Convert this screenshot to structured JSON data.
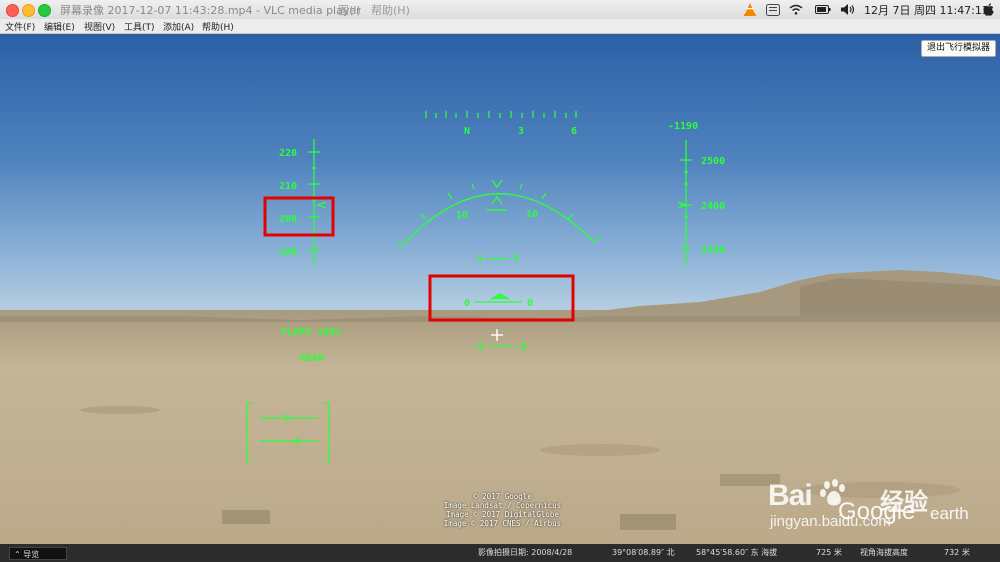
{
  "titlebar": {
    "title": "屏幕录像 2017-12-07 11:43:28.mp4 - VLC media player",
    "hidden_menu": [
      "图(I)",
      "帮助(H)"
    ],
    "clock": "12月 7日 周四 11:47:13"
  },
  "app_menu": [
    "文件(F)",
    "编辑(E)",
    "视图(V)",
    "工具(T)",
    "添加(A)",
    "帮助(H)"
  ],
  "exit_button": "退出飞行模拟器",
  "hud": {
    "heading_labels": [
      "N",
      "3",
      "6"
    ],
    "speed_labels": [
      "220",
      "210",
      "200",
      "190"
    ],
    "altitude_labels": [
      "-1190",
      "2500",
      "2400",
      "2300"
    ],
    "pitch_labels": [
      "10",
      "10",
      "5",
      "5",
      "0",
      "0",
      "-5",
      "-5"
    ],
    "flaps": "FLAPS 100%",
    "gear": "GEAR"
  },
  "credits": [
    "© 2017 Google",
    "Image Landsat / Copernicus",
    "Image © 2017 DigitalGlobe",
    "Image © 2017 CNES / Airbus"
  ],
  "statusbar": {
    "nav_button": "导览",
    "date": "影像拍摄日期: 2008/4/28",
    "lat": "39°08′08.89″ 北",
    "lon": "58°45′58.60″ 东 海拔",
    "elev": "725 米",
    "eye_label": "视角海拔高度",
    "eye_alt": "732 米"
  },
  "watermark": {
    "baidu": "Bai",
    "jingyan": "经验",
    "url": "jingyan.baidu.com",
    "google": "Google",
    "earth": "earth"
  },
  "colors": {
    "hud": "#2bff3a",
    "highlight": "#e60000"
  }
}
